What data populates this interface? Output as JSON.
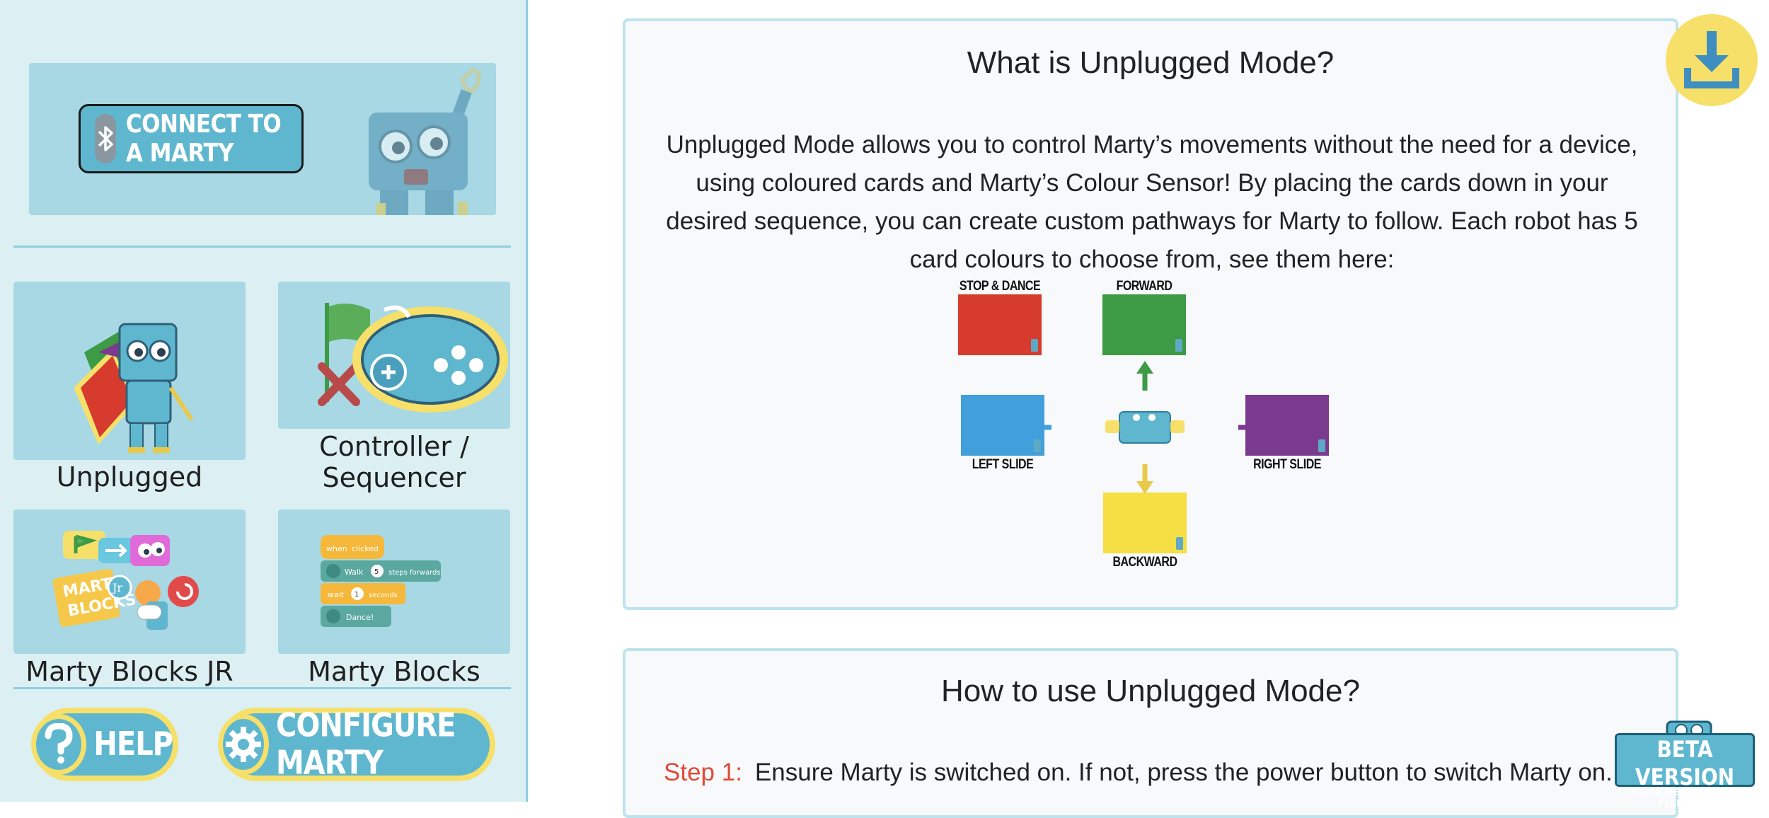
{
  "sidebar": {
    "connect_label": "CONNECT TO A MARTY",
    "tiles": [
      {
        "label": "Unplugged"
      },
      {
        "label": "Controller /"
      },
      {
        "label": "Sequencer"
      },
      {
        "label": "Marty Blocks JR"
      },
      {
        "label": "Marty Blocks"
      }
    ],
    "help_label": "HELP",
    "configure_label": "CONFIGURE MARTY",
    "blocks_texts": [
      "when",
      "clicked",
      "Walk",
      "5",
      "steps forwards",
      "wait",
      "1",
      "seconds",
      "Dance!"
    ],
    "jr_logo_text": "MARTY BLOCKS"
  },
  "main": {
    "section1": {
      "title": "What is Unplugged Mode?",
      "body": "Unplugged Mode allows you to control Marty’s movements without the need for a device, using coloured cards and Marty’s Colour Sensor! By placing the cards down in your desired sequence, you can create custom pathways for Marty to follow. Each robot has 5 card colours to choose from, see them here:",
      "cards": [
        {
          "label": "STOP & DANCE",
          "color": "#d63b2e"
        },
        {
          "label": "FORWARD",
          "color": "#3d9a45"
        },
        {
          "label": "LEFT SLIDE",
          "color": "#41a0dc"
        },
        {
          "label": "RIGHT SLIDE",
          "color": "#7a3a8e"
        },
        {
          "label": "BACKWARD",
          "color": "#f5df44"
        }
      ]
    },
    "section2": {
      "title": "How to use Unplugged Mode?",
      "step_label": "Step 1:",
      "step_text": "Ensure Marty is switched on. If not, press the power button to switch Marty on."
    }
  },
  "beta": {
    "title": "BETA VERSION",
    "subtitle": "CLICK HERE TO GIVE FEEDBACK"
  },
  "icons": {
    "download": "download-icon",
    "bluetooth": "bluetooth-icon",
    "help": "question-icon",
    "configure": "gear-icon"
  },
  "colors": {
    "sidebar_bg": "#dcf0f4",
    "tile_bg": "#a7d8e4",
    "button_blue": "#5fb7cf",
    "accent_yellow": "#f6e06a",
    "step_red": "#e04a3b"
  }
}
